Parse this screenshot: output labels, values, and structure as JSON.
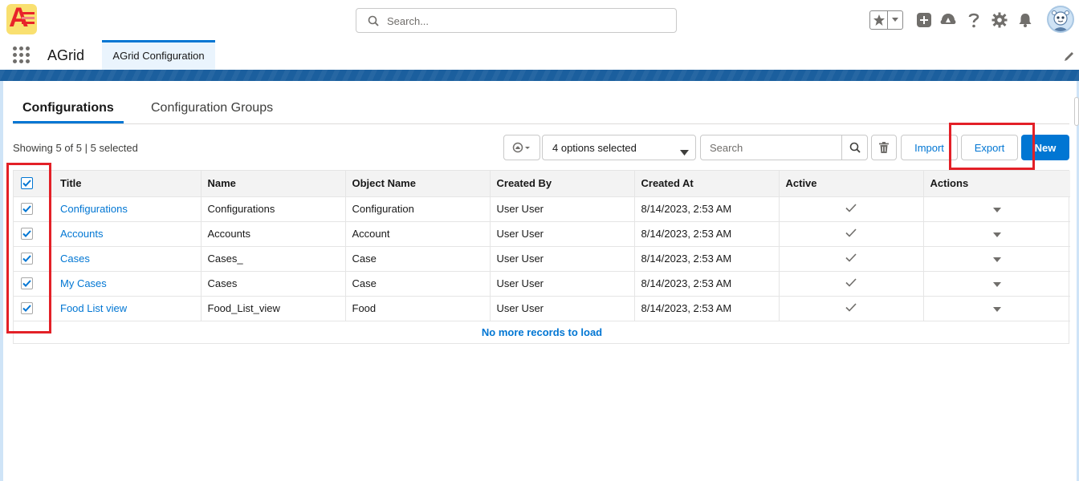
{
  "global_header": {
    "search_placeholder": "Search...",
    "icons": [
      "favorites-star-icon",
      "chevron-down-icon",
      "global-add-icon",
      "trailhead-icon",
      "help-icon",
      "setup-gear-icon",
      "notifications-bell-icon",
      "user-avatar-icon"
    ]
  },
  "app_nav": {
    "app_name": "AGrid",
    "tabs": [
      {
        "label": "AGrid Configuration",
        "active": true
      }
    ]
  },
  "main": {
    "tabs": [
      {
        "label": "Configurations",
        "active": true
      },
      {
        "label": "Configuration Groups",
        "active": false
      }
    ],
    "showing_text": "Showing 5 of 5 | 5 selected",
    "toolbar": {
      "options_value": "4 options selected",
      "search_placeholder": "Search",
      "import_label": "Import",
      "export_label": "Export",
      "new_label": "New"
    },
    "table": {
      "columns": [
        "Title",
        "Name",
        "Object Name",
        "Created By",
        "Created At",
        "Active",
        "Actions"
      ],
      "rows": [
        {
          "title": "Configurations",
          "name": "Configurations",
          "object_name": "Configuration",
          "created_by": "User User",
          "created_at": "8/14/2023, 2:53 AM",
          "active": true,
          "selected": true
        },
        {
          "title": "Accounts",
          "name": "Accounts",
          "object_name": "Account",
          "created_by": "User User",
          "created_at": "8/14/2023, 2:53 AM",
          "active": true,
          "selected": true
        },
        {
          "title": "Cases",
          "name": "Cases_",
          "object_name": "Case",
          "created_by": "User User",
          "created_at": "8/14/2023, 2:53 AM",
          "active": true,
          "selected": true
        },
        {
          "title": "My Cases",
          "name": "Cases",
          "object_name": "Case",
          "created_by": "User User",
          "created_at": "8/14/2023, 2:53 AM",
          "active": true,
          "selected": true
        },
        {
          "title": "Food List view",
          "name": "Food_List_view",
          "object_name": "Food",
          "created_by": "User User",
          "created_at": "8/14/2023, 2:53 AM",
          "active": true,
          "selected": true
        }
      ],
      "footer": "No more records to load"
    }
  },
  "colors": {
    "brand_blue": "#0176d3",
    "highlight_red": "#e32027",
    "band_blue": "#1b5f9e"
  }
}
